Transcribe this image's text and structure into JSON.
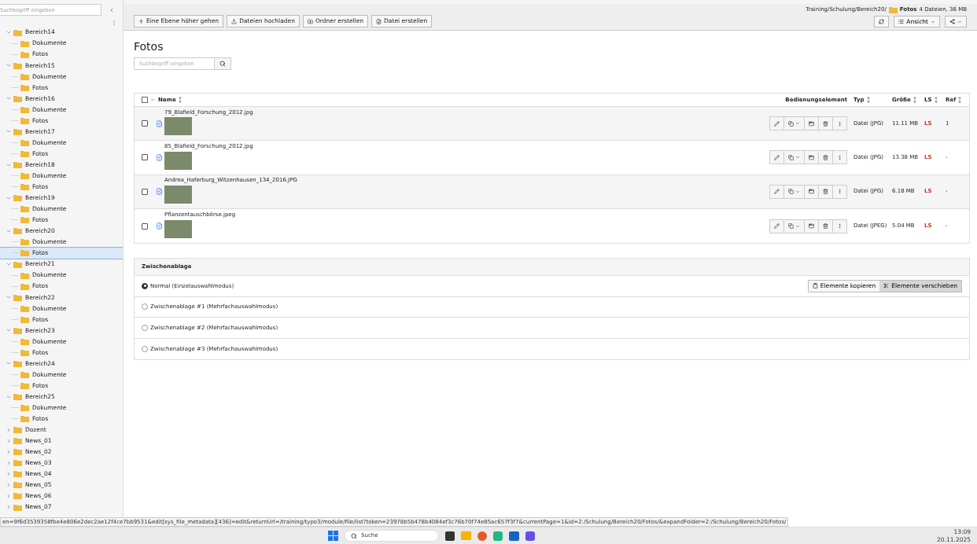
{
  "sidebar": {
    "search": {
      "placeholder": "Suchbegriff eingeben"
    },
    "tree": [
      {
        "label": "Bereich14",
        "expanded": true,
        "selected": false,
        "children": [
          {
            "label": "Dokumente",
            "selected": false
          },
          {
            "label": "Fotos",
            "selected": false
          }
        ]
      },
      {
        "label": "Bereich15",
        "expanded": true,
        "selected": false,
        "children": [
          {
            "label": "Dokumente",
            "selected": false
          },
          {
            "label": "Fotos",
            "selected": false
          }
        ]
      },
      {
        "label": "Bereich16",
        "expanded": true,
        "selected": false,
        "children": [
          {
            "label": "Dokumente",
            "selected": false
          },
          {
            "label": "Fotos",
            "selected": false
          }
        ]
      },
      {
        "label": "Bereich17",
        "expanded": true,
        "selected": false,
        "children": [
          {
            "label": "Dokumente",
            "selected": false
          },
          {
            "label": "Fotos",
            "selected": false
          }
        ]
      },
      {
        "label": "Bereich18",
        "expanded": true,
        "selected": false,
        "children": [
          {
            "label": "Dokumente",
            "selected": false
          },
          {
            "label": "Fotos",
            "selected": false
          }
        ]
      },
      {
        "label": "Bereich19",
        "expanded": true,
        "selected": false,
        "children": [
          {
            "label": "Dokumente",
            "selected": false
          },
          {
            "label": "Fotos",
            "selected": false
          }
        ]
      },
      {
        "label": "Bereich20",
        "expanded": true,
        "selected": false,
        "children": [
          {
            "label": "Dokumente",
            "selected": false
          },
          {
            "label": "Fotos",
            "selected": true
          }
        ]
      },
      {
        "label": "Bereich21",
        "expanded": true,
        "selected": false,
        "children": [
          {
            "label": "Dokumente",
            "selected": false
          },
          {
            "label": "Fotos",
            "selected": false
          }
        ]
      },
      {
        "label": "Bereich22",
        "expanded": true,
        "selected": false,
        "children": [
          {
            "label": "Dokumente",
            "selected": false
          },
          {
            "label": "Fotos",
            "selected": false
          }
        ]
      },
      {
        "label": "Bereich23",
        "expanded": true,
        "selected": false,
        "children": [
          {
            "label": "Dokumente",
            "selected": false
          },
          {
            "label": "Fotos",
            "selected": false
          }
        ]
      },
      {
        "label": "Bereich24",
        "expanded": true,
        "selected": false,
        "children": [
          {
            "label": "Dokumente",
            "selected": false
          },
          {
            "label": "Fotos",
            "selected": false
          }
        ]
      },
      {
        "label": "Bereich25",
        "expanded": true,
        "selected": false,
        "children": [
          {
            "label": "Dokumente",
            "selected": false
          },
          {
            "label": "Fotos",
            "selected": false
          }
        ]
      },
      {
        "label": "Dozent",
        "expanded": false,
        "selected": false
      },
      {
        "label": "News_01",
        "expanded": false,
        "selected": false
      },
      {
        "label": "News_02",
        "expanded": false,
        "selected": false
      },
      {
        "label": "News_03",
        "expanded": false,
        "selected": false
      },
      {
        "label": "News_04",
        "expanded": false,
        "selected": false
      },
      {
        "label": "News_05",
        "expanded": false,
        "selected": false
      },
      {
        "label": "News_06",
        "expanded": false,
        "selected": false
      },
      {
        "label": "News_07",
        "expanded": false,
        "selected": false
      }
    ]
  },
  "toolbar": {
    "buttons": [
      {
        "kind": "up",
        "label": "Eine Ebene höher gehen"
      },
      {
        "kind": "upload",
        "label": "Dateien hochladen"
      },
      {
        "kind": "folder",
        "label": "Ordner erstellen"
      },
      {
        "kind": "file",
        "label": "Datei erstellen"
      }
    ],
    "breadcrumb": {
      "path": "Training/Schulung/Bereich20/",
      "folder": "Fotos",
      "info": "4 Dateien, 36 MB"
    },
    "view_button": "Ansicht"
  },
  "page": {
    "title": "Fotos",
    "search": {
      "placeholder": "Suchbegriff eingeben"
    }
  },
  "table": {
    "all_selected": false,
    "columns": [
      "Name",
      "Bedienungselement",
      "Typ",
      "Größe",
      "LS",
      "Ref"
    ],
    "rows": [
      {
        "name": "79_Blafield_Forschung_2012.jpg",
        "checked": false,
        "type": "Datei (JPG)",
        "size": "11.11 MB",
        "ls": "LS",
        "ref": "1"
      },
      {
        "name": "85_Blafield_Forschung_2012.jpg",
        "checked": false,
        "type": "Datei (JPG)",
        "size": "13.38 MB",
        "ls": "LS",
        "ref": "-"
      },
      {
        "name": "Andrea_Haferburg_Witzenhausen_134_2016.JPG",
        "checked": false,
        "type": "Datei (JPG)",
        "size": "6.18 MB",
        "ls": "LS",
        "ref": "-"
      },
      {
        "name": "Pflanzentauschbörse.jpeg",
        "checked": false,
        "type": "Datei (JPEG)",
        "size": "5.04 MB",
        "ls": "LS",
        "ref": "-"
      }
    ]
  },
  "clipboard": {
    "title": "Zwischenablage",
    "modes": [
      {
        "label": "Normal (Einzelauswahlmodus)",
        "selected": true
      },
      {
        "label": "Zwischenablage #1 (Mehrfachauswahlmodus)",
        "selected": false
      },
      {
        "label": "Zwischenablage #2 (Mehrfachauswahlmodus)",
        "selected": false
      },
      {
        "label": "Zwischenablage #3 (Mehrfachauswahlmodus)",
        "selected": false
      }
    ],
    "buttons": [
      {
        "kind": "copy",
        "label": "Elemente kopieren",
        "selected": false
      },
      {
        "kind": "move",
        "label": "Elemente verschieben",
        "selected": true
      }
    ]
  },
  "status_url": "en=9f6d3539358fbe4e806e2dec2ae12f4ce7bb9531&edit[sys_file_metadata][436]=edit&returnUrl=/training/typo3/module/file/list?token=23978b5b478b4084ef3c76b70f74e85ac657f3f7&currentPage=1&id=2:/Schulung/Bereich20/Fotos/&expandFolder=2:/Schulung/Bereich20/Fotos/",
  "taskbar": {
    "search_placeholder": "Suche",
    "time": "13:09",
    "date": "20.11.2025"
  }
}
